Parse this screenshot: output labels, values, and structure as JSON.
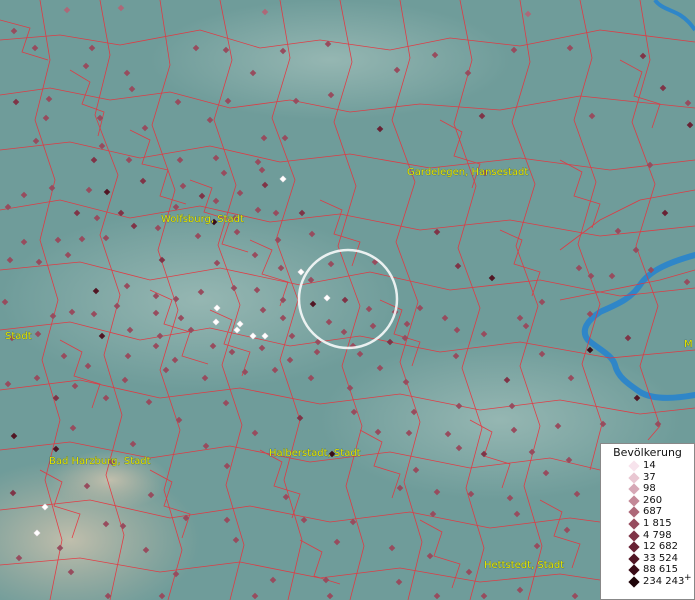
{
  "map": {
    "colors": {
      "background": "#6f9c9a",
      "border": "#e8323c",
      "river": "#2f86c8",
      "circle": "#ffffff",
      "label": "#e6e600"
    },
    "city_labels": [
      {
        "id": "gardelegen",
        "text": "Gardelegen, Hansestadt"
      },
      {
        "id": "wolfsburg",
        "text": "Wolfsburg, Stadt"
      },
      {
        "id": "bad-harzburg",
        "text": "Bad Harzburg, Stadt"
      },
      {
        "id": "halberstadt",
        "text": "Halberstadt, Stadt"
      },
      {
        "id": "hettstedt",
        "text": "Hettstedt, Stadt"
      },
      {
        "id": "left-stadt",
        "text": "Stadt"
      },
      {
        "id": "right-m",
        "text": "M"
      }
    ]
  },
  "legend": {
    "title": "Bevölkerung",
    "items": [
      {
        "label": "14",
        "color": "#f7e3ec"
      },
      {
        "label": "37",
        "color": "#e9c7d2"
      },
      {
        "label": "98",
        "color": "#d6a8b6"
      },
      {
        "label": "260",
        "color": "#c38897"
      },
      {
        "label": "687",
        "color": "#ad6878"
      },
      {
        "label": "1 815",
        "color": "#974c5e"
      },
      {
        "label": "4 798",
        "color": "#7f3447"
      },
      {
        "label": "12 682",
        "color": "#682234"
      },
      {
        "label": "33 524",
        "color": "#511624"
      },
      {
        "label": "88 615",
        "color": "#3a0c17"
      },
      {
        "label": "234 243",
        "color": "#1f0509"
      }
    ],
    "overflow_mark": "+"
  }
}
